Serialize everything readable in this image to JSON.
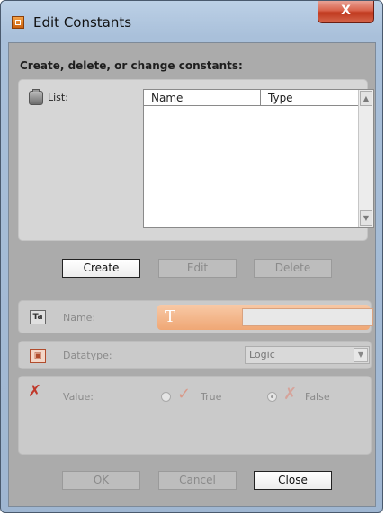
{
  "window": {
    "title": "Edit Constants",
    "close_glyph": "X"
  },
  "main": {
    "heading": "Create, delete, or change constants:",
    "list_label": "List:",
    "columns": [
      "Name",
      "Type"
    ],
    "scroll_up": "▲",
    "scroll_down": "▼",
    "buttons": {
      "create": "Create",
      "edit": "Edit",
      "delete": "Delete"
    },
    "name_label": "Name:",
    "name_value": "",
    "datatype_label": "Datatype:",
    "datatype_value": "Logic",
    "datatype_arrow": "▼",
    "value_label": "Value:",
    "value_true": "True",
    "value_false": "False"
  },
  "footer": {
    "ok": "OK",
    "cancel": "Cancel",
    "close": "Close"
  },
  "icons": {
    "name": "text-field-icon",
    "datatype": "datatype-icon",
    "value": "value-icon",
    "true": "check-icon",
    "false": "cross-icon"
  }
}
